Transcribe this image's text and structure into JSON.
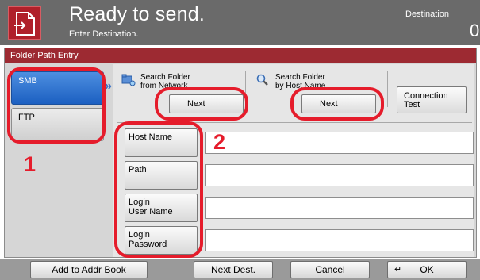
{
  "header": {
    "title": "Ready to send.",
    "subtitle": "Enter Destination.",
    "destination_label": "Destination",
    "destination_count": "0",
    "icon": "send-document-icon"
  },
  "dialog": {
    "title": "Folder Path Entry",
    "tabs": [
      {
        "label": "SMB",
        "selected": true
      },
      {
        "label": "FTP",
        "selected": false
      }
    ],
    "search": {
      "network_label": "Search Folder\nfrom Network",
      "network_icon": "network-folder-icon",
      "network_button": "Next",
      "host_label": "Search Folder\nby Host Name",
      "host_icon": "magnifier-icon",
      "host_button": "Next",
      "connection_test": "Connection\nTest"
    },
    "fields": [
      {
        "label": "Host Name",
        "value": ""
      },
      {
        "label": "Path",
        "value": ""
      },
      {
        "label": "Login\nUser Name",
        "value": ""
      },
      {
        "label": "Login\nPassword",
        "value": ""
      }
    ]
  },
  "callouts": {
    "one": "1",
    "two": "2",
    "color": "#e51c2b"
  },
  "bottom_bar": {
    "add_to_addr_book": "Add to Addr Book",
    "next_dest": "Next Dest.",
    "cancel": "Cancel",
    "ok": "OK"
  },
  "colors": {
    "header_bg": "#6a6a6a",
    "accent_red": "#9d2a32",
    "selected_tab_blue": "#1b5fc1"
  }
}
